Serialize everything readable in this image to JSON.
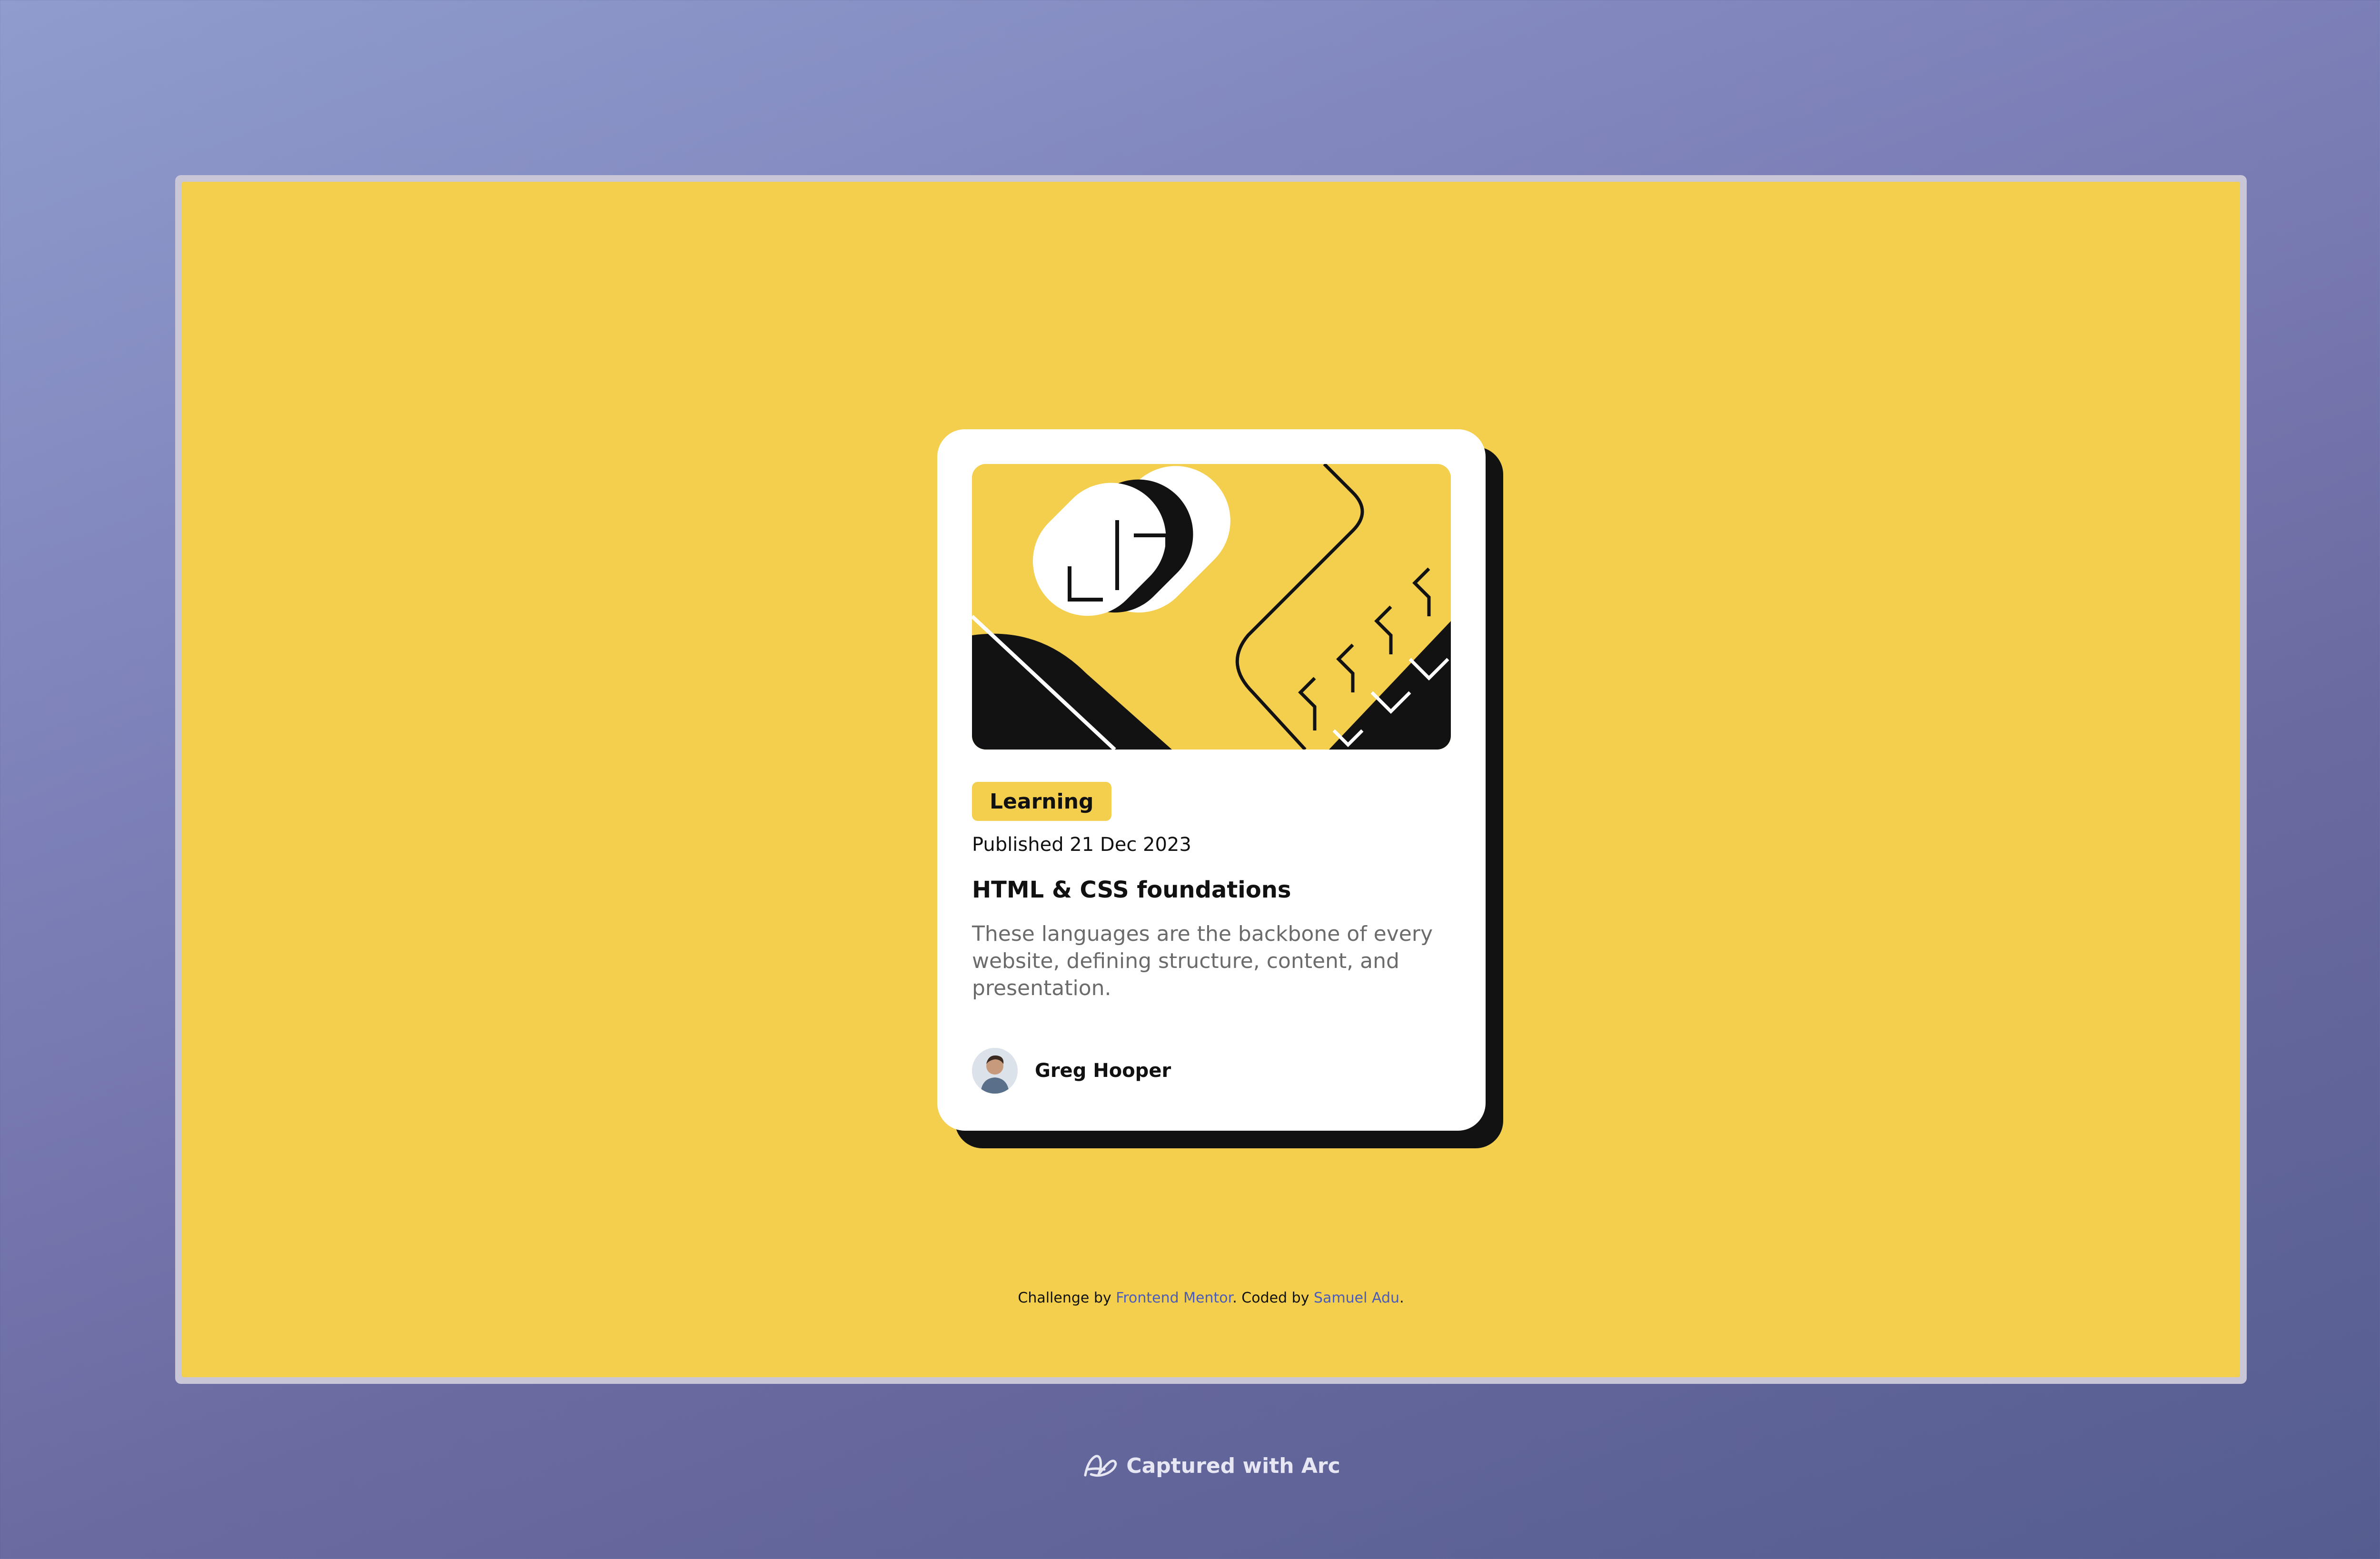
{
  "card": {
    "tag": "Learning",
    "published": "Published 21 Dec 2023",
    "title": "HTML & CSS foundations",
    "description": "These languages are the backbone of every website, defining structure, content, and presentation.",
    "author_name": "Greg Hooper"
  },
  "attribution": {
    "prefix": "Challenge by ",
    "frontend_mentor": "Frontend Mentor",
    "middle": ". Coded by ",
    "coder": "Samuel Adu",
    "suffix": "."
  },
  "footer": {
    "captured": "Captured with Arc"
  },
  "colors": {
    "page_yellow": "#f3cf4d",
    "card_white": "#ffffff",
    "shadow_black": "#121212",
    "link_blue": "#4a5bb8",
    "description_gray": "#6b6b6b"
  },
  "icons": {
    "hero": "abstract-illustration",
    "avatar": "person-avatar",
    "arc": "arc-logo-icon"
  }
}
